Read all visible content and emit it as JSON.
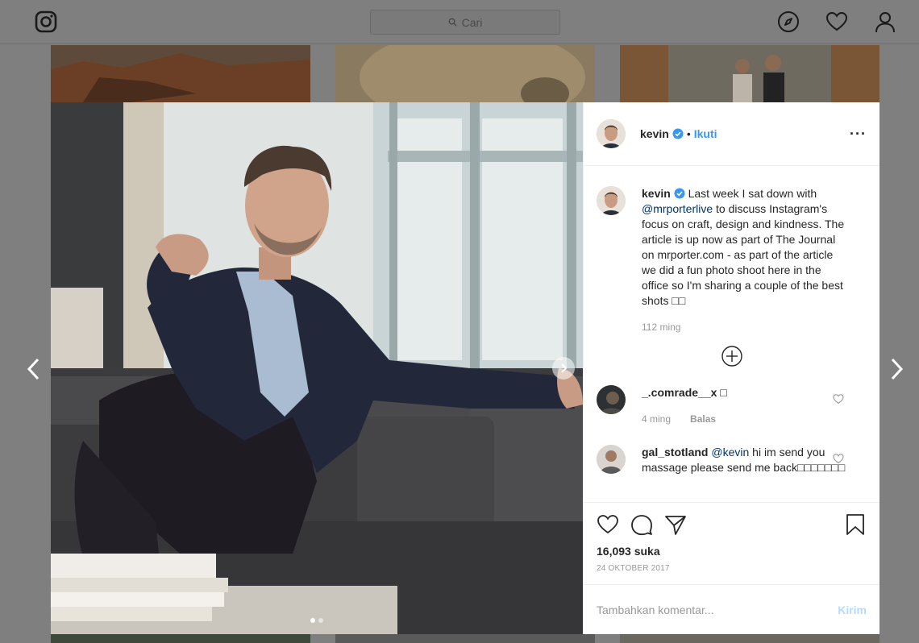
{
  "search": {
    "placeholder": "Cari"
  },
  "post": {
    "author": "kevin",
    "follow_label": "Ikuti",
    "more_label": "···",
    "caption": {
      "username": "kevin",
      "text_before_mention": "Last week I sat down with",
      "mention": "@mrporterlive",
      "text_after_mention": "to discuss Instagram's focus on craft, design and kindness. The article is up now as part of The Journal on mrporter.com - as part of the article we did a fun photo shoot here in the office so I'm sharing a couple of the best shots □□",
      "age": "112 ming"
    },
    "comments": [
      {
        "username": "_.comrade__x",
        "text": "□",
        "age": "4 ming",
        "reply_label": "Balas"
      },
      {
        "username": "gal_stotland",
        "mention": "@kevin",
        "text": "hi im send you massage please send me back□□□□□□□"
      }
    ],
    "likes": "16,093 suka",
    "date": "24 OKTOBER 2017",
    "add_comment_placeholder": "Tambahkan komentar...",
    "post_button": "Kirim"
  },
  "icons": [
    "instagram-logo-icon",
    "compass-icon",
    "heart-icon",
    "profile-icon",
    "chevron-left-icon",
    "chevron-right-icon",
    "comment-icon",
    "share-icon",
    "bookmark-icon",
    "plus-circle-icon",
    "verified-icon"
  ],
  "colors": {
    "link": "#3897f0",
    "overlay": "#7f7f7f",
    "post_disabled": "#b3dbff"
  }
}
